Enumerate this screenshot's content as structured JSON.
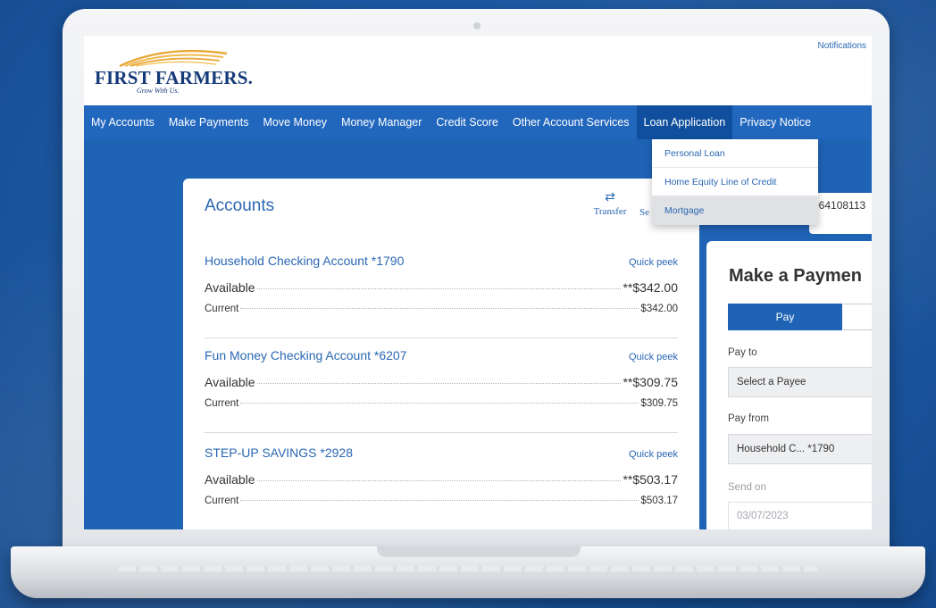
{
  "header": {
    "logo_name": "FIRST FARMERS.",
    "logo_tagline": "Grow With Us.",
    "notifications_label": "Notifications"
  },
  "nav": {
    "items": [
      {
        "label": "My Accounts"
      },
      {
        "label": "Make Payments"
      },
      {
        "label": "Move Money"
      },
      {
        "label": "Money Manager"
      },
      {
        "label": "Credit Score"
      },
      {
        "label": "Other Account Services"
      },
      {
        "label": "Loan Application"
      },
      {
        "label": "Privacy Notice"
      }
    ],
    "active_index": 6
  },
  "loan_menu": {
    "items": [
      {
        "label": "Personal Loan"
      },
      {
        "label": "Home Equity Line of Credit"
      },
      {
        "label": "Mortgage"
      }
    ],
    "highlighted": "Mortgage"
  },
  "accounts": {
    "title": "Accounts",
    "transfer_label": "Transfer",
    "settings_label_partial": "Se",
    "quick_peek_label": "Quick peek",
    "available_label": "Available",
    "current_label": "Current",
    "list": [
      {
        "name": "Household Checking Account  *1790",
        "available": "**$342.00",
        "current": "$342.00"
      },
      {
        "name": "Fun Money Checking Account  *6207",
        "available": "**$309.75",
        "current": "$309.75"
      },
      {
        "name": "STEP-UP SAVINGS  *2928",
        "available": "**$503.17",
        "current": "$503.17"
      }
    ]
  },
  "account_strip": {
    "number_partial": "064108113"
  },
  "payment": {
    "title": "Make a Paymen",
    "pay_tab": "Pay",
    "pay_to_label": "Pay to",
    "payee_placeholder": "Select a Payee",
    "pay_from_label": "Pay from",
    "pay_from_value": "Household C... *1790",
    "send_on_label": "Send on",
    "send_on_value": "03/07/2023"
  },
  "colors": {
    "brand_blue": "#2267be",
    "active_nav": "#0f4f9e",
    "link_blue": "#2a67b3",
    "logo_navy": "#143a78",
    "logo_gold": "#e8a93a"
  },
  "icons": {
    "logo_swoosh": "sun-rays-logo-icon",
    "transfer": "arrows-swap-icon"
  }
}
